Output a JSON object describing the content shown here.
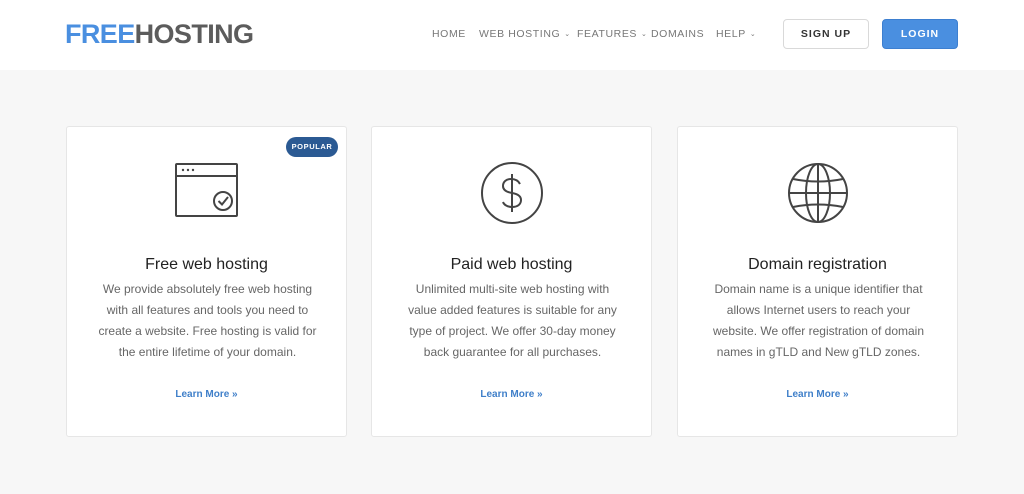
{
  "logo": {
    "part1": "FREE",
    "part2": "HOSTING"
  },
  "nav": {
    "home": "HOME",
    "web_hosting": "WEB HOSTING",
    "features": "FEATURES",
    "domains": "DOMAINS",
    "help": "HELP",
    "caret": "⌄"
  },
  "buttons": {
    "signup": "SIGN UP",
    "login": "LOGIN"
  },
  "cards": [
    {
      "badge": "POPULAR",
      "title": "Free web hosting",
      "desc": "We provide absolutely free web hosting with all features and tools you need to create a website. Free hosting is valid for the entire lifetime of your domain.",
      "more": "Learn More »"
    },
    {
      "title": "Paid web hosting",
      "desc": "Unlimited multi-site web hosting with value added features is suitable for any type of project. We offer 30-day money back guarantee for all purchases.",
      "more": "Learn More »"
    },
    {
      "title": "Domain registration",
      "desc": "Domain name is a unique identifier that allows Internet users to reach your website. We offer registration of domain names in gTLD and New gTLD zones.",
      "more": "Learn More »"
    }
  ],
  "icons": {
    "card1": "browser-check-icon",
    "card2": "dollar-coin-icon",
    "card3": "globe-icon"
  },
  "colors": {
    "accent": "#4a8fe0",
    "logo_gray": "#5c5c5c",
    "badge": "#2b5a93",
    "link": "#3f7fc9",
    "background": "#f7f7f7"
  }
}
